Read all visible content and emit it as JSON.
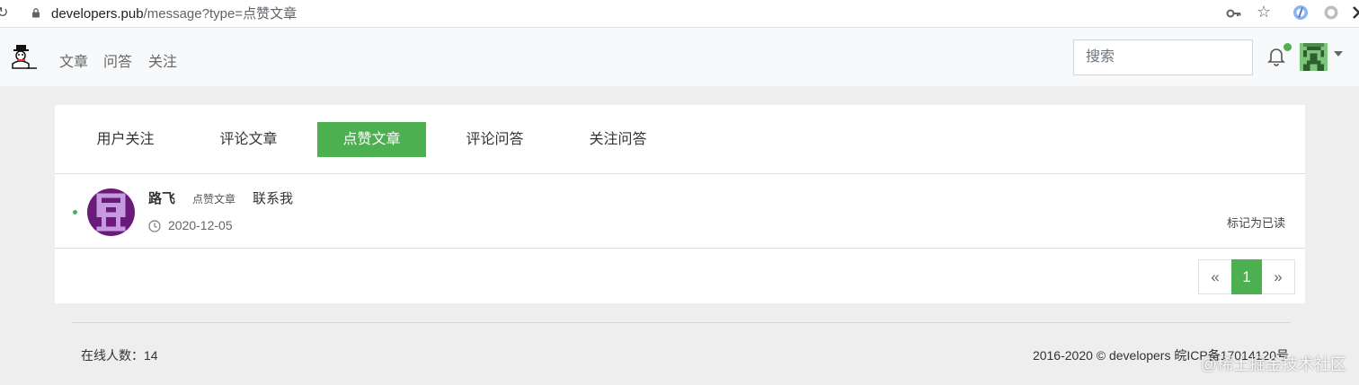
{
  "browser": {
    "reload_icon": "reload-icon",
    "url_host": "developers.pub",
    "url_path": "/message?type=点赞文章",
    "icons": [
      "key-icon",
      "star-icon",
      "extension-icon",
      "circle-icon",
      "puzzle-icon"
    ]
  },
  "nav": {
    "logo": "snowman-logo",
    "links": [
      "文章",
      "问答",
      "关注"
    ],
    "search_placeholder": "搜索",
    "notification_dot_color": "#4caf50"
  },
  "tabs": [
    {
      "label": "用户关注",
      "active": false
    },
    {
      "label": "评论文章",
      "active": false
    },
    {
      "label": "点赞文章",
      "active": true
    },
    {
      "label": "评论问答",
      "active": false
    },
    {
      "label": "关注问答",
      "active": false
    }
  ],
  "message": {
    "user": "路飞",
    "action": "点赞文章",
    "contact": "联系我",
    "date": "2020-12-05",
    "mark_read": "标记为已读"
  },
  "pagination": {
    "prev": "«",
    "current": "1",
    "next": "»"
  },
  "footer": {
    "online": "在线人数：14",
    "copyright": "2016-2020 © developers 皖ICP备17014120号",
    "watermark": "@稀土掘金技术社区"
  },
  "colors": {
    "accent": "#4caf50",
    "page_bg": "#eeeeee",
    "nav_bg": "#f8f9fa"
  }
}
